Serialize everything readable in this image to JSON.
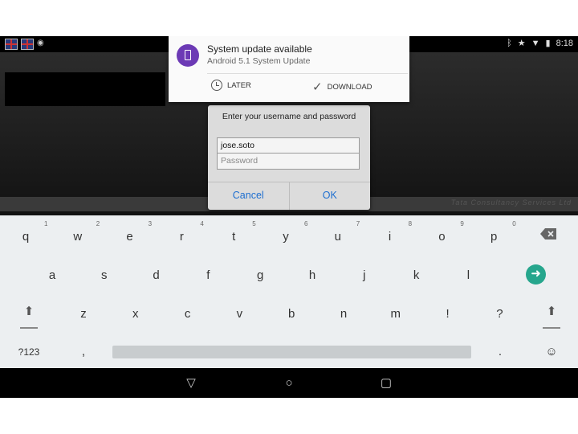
{
  "status_bar": {
    "time": "8:18",
    "left_icons": [
      "flag-icon",
      "flag-icon",
      "android-icon"
    ],
    "right_icons": [
      "bluetooth-icon",
      "star-icon",
      "wifi-icon",
      "battery-icon"
    ]
  },
  "notification": {
    "title": "System update available",
    "subtitle": "Android 5.1 System Update",
    "later_label": "LATER",
    "download_label": "DOWNLOAD",
    "accent": "#6c3ab5"
  },
  "dialog": {
    "message": "Enter your username and password",
    "username_value": "jose.soto",
    "password_placeholder": "Password",
    "cancel_label": "Cancel",
    "ok_label": "OK"
  },
  "app": {
    "footer_text": "Tata Consultancy Services Ltd"
  },
  "keyboard": {
    "row1": [
      "q",
      "w",
      "e",
      "r",
      "t",
      "y",
      "u",
      "i",
      "o",
      "p"
    ],
    "row1_hints": [
      "1",
      "2",
      "3",
      "4",
      "5",
      "6",
      "7",
      "8",
      "9",
      "0"
    ],
    "row2": [
      "a",
      "s",
      "d",
      "f",
      "g",
      "h",
      "j",
      "k",
      "l"
    ],
    "row3": [
      "z",
      "x",
      "c",
      "v",
      "b",
      "n",
      "m",
      "!",
      "?"
    ],
    "symbols_label": "?123",
    "comma": ",",
    "period": ".",
    "accent": "#26a68d"
  },
  "nav_icons": [
    "back-icon",
    "home-icon",
    "recents-icon"
  ]
}
